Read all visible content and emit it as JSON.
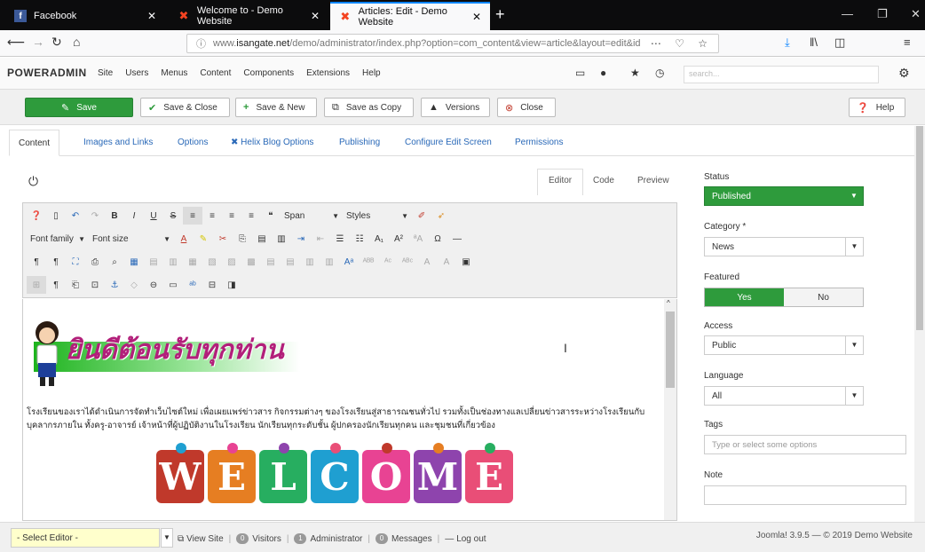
{
  "browser": {
    "tabs": [
      {
        "title": "Facebook",
        "icon": "facebook-icon"
      },
      {
        "title": "Welcome to - Demo Website",
        "icon": "joomla-icon"
      },
      {
        "title": "Articles: Edit - Demo Website",
        "icon": "joomla-icon"
      }
    ],
    "url_prefix": "www.",
    "url_domain": "isangate.net",
    "url_path": "/demo/administrator/index.php?option=com_content&view=article&layout=edit&id"
  },
  "header": {
    "brand": "POWERADMIN",
    "menu": [
      "Site",
      "Users",
      "Menus",
      "Content",
      "Components",
      "Extensions",
      "Help"
    ],
    "search_placeholder": "search..."
  },
  "toolbar": {
    "save": "Save",
    "save_close": "Save & Close",
    "save_new": "Save & New",
    "save_copy": "Save as Copy",
    "versions": "Versions",
    "close": "Close",
    "help": "Help"
  },
  "content_tabs": [
    "Content",
    "Images and Links",
    "Options",
    "Helix Blog Options",
    "Publishing",
    "Configure Edit Screen",
    "Permissions"
  ],
  "editor": {
    "modes": [
      "Editor",
      "Code",
      "Preview"
    ],
    "format_select": "Span",
    "styles_select": "Styles",
    "font_family": "Font family",
    "font_size": "Font size",
    "banner_text": "ยินดีต้อนรับทุกท่าน",
    "paragraph": "โรงเรียนของเราได้ดำเนินการจัดทำเว็บไซต์ใหม่ เพื่อเผยแพร่ข่าวสาร กิจกรรมต่างๆ ของโรงเรียนสู่สาธารณชนทั่วไป รวมทั้งเป็นช่องทางแลเปลี่ยนข่าวสารระหว่างโรงเรียนกับบุคลากรภายใน ทั้งครู-อาจารย์ เจ้าหน้าที่ผู้ปฏิบัติงานในโรงเรียน นักเรียนทุกระดับชั้น ผู้ปกครองนักเรียนทุกคน และชุมชนที่เกี่ยวข้อง",
    "welcome_letters": [
      "W",
      "E",
      "L",
      "C",
      "O",
      "M",
      "E"
    ],
    "welcome_colors": [
      "#c0392b",
      "#e67e22",
      "#27ae60",
      "#1f9fd1",
      "#e84393",
      "#8e44ad",
      "#e94e77"
    ]
  },
  "sidebar": {
    "status_label": "Status",
    "status_value": "Published",
    "category_label": "Category *",
    "category_value": "News",
    "featured_label": "Featured",
    "featured_yes": "Yes",
    "featured_no": "No",
    "access_label": "Access",
    "access_value": "Public",
    "language_label": "Language",
    "language_value": "All",
    "tags_label": "Tags",
    "tags_placeholder": "Type or select some options",
    "note_label": "Note"
  },
  "statusbar": {
    "select_editor": "- Select Editor -",
    "view_site": "View Site",
    "visitors_count": "0",
    "visitors": "Visitors",
    "admin_count": "1",
    "administrator": "Administrator",
    "messages_count": "0",
    "messages": "Messages",
    "logout": "Log out",
    "footer": "Joomla! 3.9.5 — © 2019 Demo Website"
  },
  "colors": {
    "primary_green": "#2e9b3c",
    "link_blue": "#2a69b8",
    "firefox_accent": "#0a84ff"
  }
}
